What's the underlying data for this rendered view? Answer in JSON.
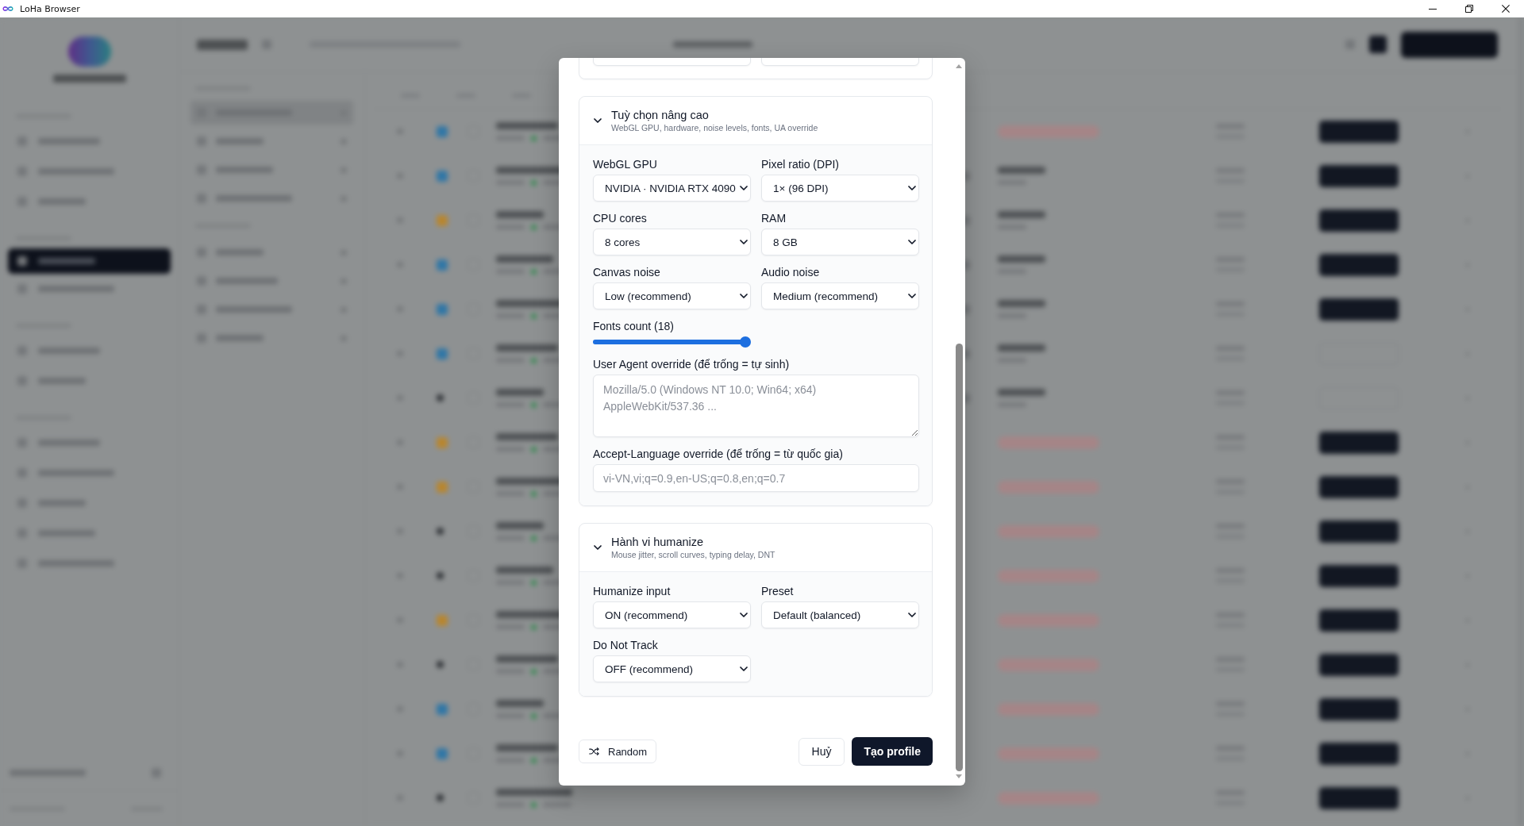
{
  "window": {
    "title": "LoHa Browser"
  },
  "dialog": {
    "cut_off_section": {
      "fields": [
        {
          "kind": "input"
        },
        {
          "kind": "input"
        }
      ]
    },
    "sections": [
      {
        "title": "Tuỳ chọn nâng cao",
        "subtitle": "WebGL GPU, hardware, noise levels, fonts, UA override",
        "expanded": true,
        "fields": [
          {
            "kind": "select",
            "label": "WebGL GPU",
            "value": "NVIDIA · NVIDIA RTX 4090"
          },
          {
            "kind": "select",
            "label": "Pixel ratio (DPI)",
            "value": "1× (96 DPI)"
          },
          {
            "kind": "select",
            "label": "CPU cores",
            "value": "8 cores"
          },
          {
            "kind": "select",
            "label": "RAM",
            "value": "8 GB"
          },
          {
            "kind": "select",
            "label": "Canvas noise",
            "value": "Low (recommend)"
          },
          {
            "kind": "select",
            "label": "Audio noise",
            "value": "Medium (recommend)"
          },
          {
            "kind": "slider",
            "label": "Fonts count (18)",
            "level": 1
          },
          {
            "kind": "textarea",
            "label": "User Agent override (để trống = tự sinh)",
            "placeholder": "Mozilla/5.0 (Windows NT 10.0; Win64; x64) AppleWebKit/537.36 ..."
          },
          {
            "kind": "input",
            "label": "Accept-Language override (để trống = từ quốc gia)",
            "placeholder": "vi-VN,vi;q=0.9,en-US;q=0.8,en;q=0.7"
          }
        ]
      },
      {
        "title": "Hành vi humanize",
        "subtitle": "Mouse jitter, scroll curves, typing delay, DNT",
        "expanded": true,
        "fields": [
          {
            "kind": "select",
            "label": "Humanize input",
            "value": "ON (recommend)"
          },
          {
            "kind": "select",
            "label": "Preset",
            "value": "Default (balanced)"
          },
          {
            "kind": "select",
            "label": "Do Not Track",
            "value": "OFF (recommend)"
          }
        ]
      }
    ],
    "buttons": [
      {
        "kind": "random",
        "label": "Random"
      },
      {
        "kind": "cancel",
        "label": "Huỷ"
      },
      {
        "kind": "submit",
        "label": "Tạo profile"
      }
    ]
  }
}
